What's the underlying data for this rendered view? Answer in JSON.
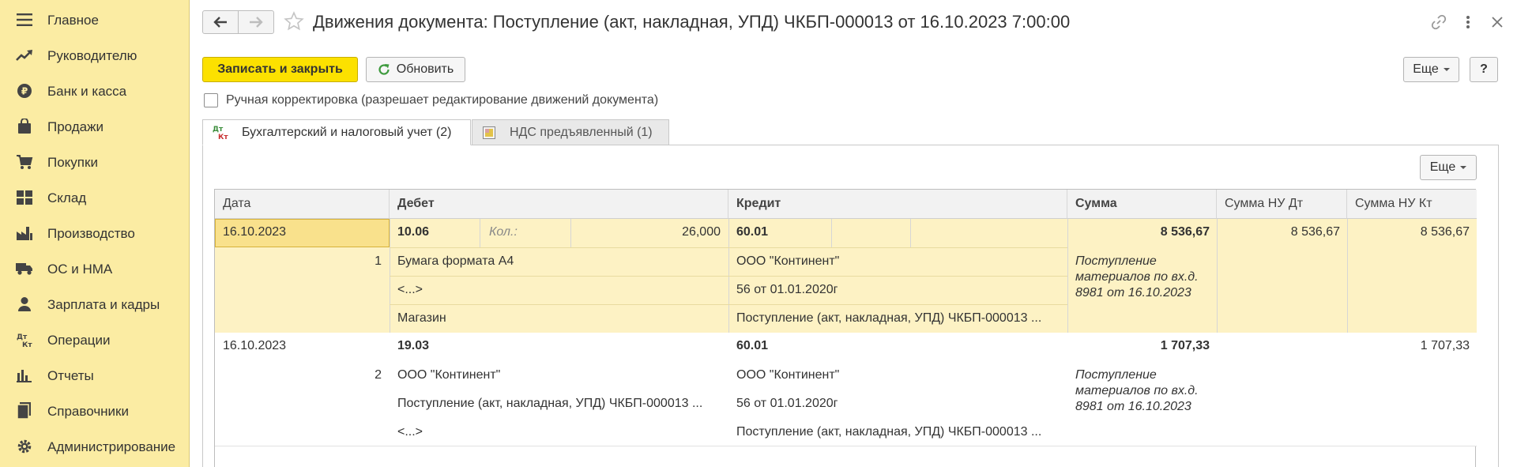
{
  "sidebar": {
    "items": [
      {
        "label": "Главное",
        "icon": "menu-icon"
      },
      {
        "label": "Руководителю",
        "icon": "trend-icon"
      },
      {
        "label": "Банк и касса",
        "icon": "ruble-icon"
      },
      {
        "label": "Продажи",
        "icon": "bag-icon"
      },
      {
        "label": "Покупки",
        "icon": "cart-icon"
      },
      {
        "label": "Склад",
        "icon": "warehouse-icon"
      },
      {
        "label": "Производство",
        "icon": "factory-icon"
      },
      {
        "label": "ОС и НМА",
        "icon": "truck-icon"
      },
      {
        "label": "Зарплата и кадры",
        "icon": "person-icon"
      },
      {
        "label": "Операции",
        "icon": "dt-kt-icon"
      },
      {
        "label": "Отчеты",
        "icon": "bar-chart-icon"
      },
      {
        "label": "Справочники",
        "icon": "books-icon"
      },
      {
        "label": "Администрирование",
        "icon": "gear-icon"
      }
    ]
  },
  "window": {
    "title": "Движения документа: Поступление (акт, накладная, УПД) ЧКБП-000013 от 16.10.2023 7:00:00"
  },
  "toolbar": {
    "save_label": "Записать и закрыть",
    "refresh_label": "Обновить",
    "more_label": "Еще",
    "help_label": "?"
  },
  "manual_correction": {
    "checked": false,
    "label": "Ручная корректировка (разрешает редактирование движений документа)"
  },
  "tabs": [
    {
      "label": "Бухгалтерский и налоговый учет (2)",
      "active": true
    },
    {
      "label": "НДС предъявленный (1)",
      "active": false
    }
  ],
  "table": {
    "more_label": "Еще",
    "columns": [
      "Дата",
      "Дебет",
      "Кредит",
      "Сумма",
      "Сумма НУ Дт",
      "Сумма НУ Кт"
    ],
    "rows": [
      {
        "date": "16.10.2023",
        "number": "1",
        "debit_account": "10.06",
        "qty_label": "Кол.:",
        "qty_value": "26,000",
        "debit_sub1": "Бумага формата А4",
        "debit_sub2": "<...>",
        "debit_sub3": "Магазин",
        "credit_account": "60.01",
        "credit_sub1": "ООО \"Континент\"",
        "credit_sub2": "56 от 01.01.2020г",
        "credit_sub3": "Поступление (акт, накладная, УПД) ЧКБП-000013 ...",
        "amount": "8 536,67",
        "content": "Поступление материалов по вх.д. 8981 от 16.10.2023",
        "nu_dt": "8 536,67",
        "nu_kt": "8 536,67"
      },
      {
        "date": "16.10.2023",
        "number": "2",
        "debit_account": "19.03",
        "debit_sub1": "ООО \"Континент\"",
        "debit_sub2": "Поступление (акт, накладная, УПД) ЧКБП-000013 ...",
        "debit_sub3": "<...>",
        "credit_account": "60.01",
        "credit_sub1": "ООО \"Континент\"",
        "credit_sub2": "56 от 01.01.2020г",
        "credit_sub3": "Поступление (акт, накладная, УПД) ЧКБП-000013 ...",
        "amount": "1 707,33",
        "content": "Поступление материалов по вх.д. 8981 от 16.10.2023",
        "nu_dt": "",
        "nu_kt": "1 707,33"
      }
    ]
  },
  "colors": {
    "sidebar_bg": "#fbeca3",
    "save_button": "#fce100",
    "selected_row": "#fdf2c4"
  }
}
